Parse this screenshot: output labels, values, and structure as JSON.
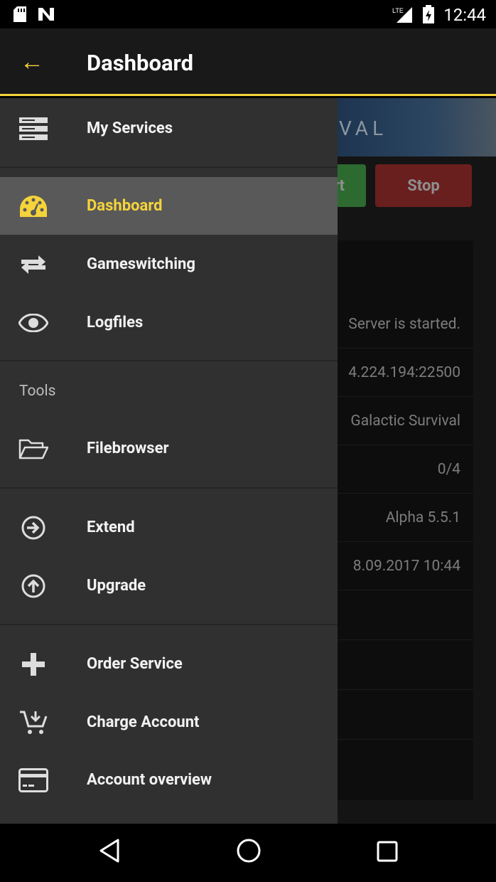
{
  "status_bar": {
    "time": "12:44",
    "network": "LTE"
  },
  "app_bar": {
    "title": "Dashboard",
    "back_icon": "arrow-back-icon"
  },
  "background": {
    "banner_text": "VAL",
    "start_label": "rt",
    "stop_label": "Stop",
    "rows": [
      "Server is started.",
      "4.224.194:22500",
      "Galactic Survival",
      "0/4",
      "Alpha 5.5.1",
      "8.09.2017 10:44",
      "",
      "",
      ""
    ]
  },
  "drawer": {
    "my_services": "My Services",
    "items": [
      {
        "label": "Dashboard",
        "icon": "speedometer-icon"
      },
      {
        "label": "Gameswitching",
        "icon": "swap-icon"
      },
      {
        "label": "Logfiles",
        "icon": "eye-icon"
      }
    ],
    "tools_header": "Tools",
    "filebrowser": "Filebrowser",
    "extend": "Extend",
    "upgrade": "Upgrade",
    "order_service": "Order Service",
    "charge_account": "Charge Account",
    "account_overview": "Account overview"
  },
  "colors": {
    "accent": "#f5d33a",
    "drawer": "#303030",
    "active": "#595959"
  }
}
